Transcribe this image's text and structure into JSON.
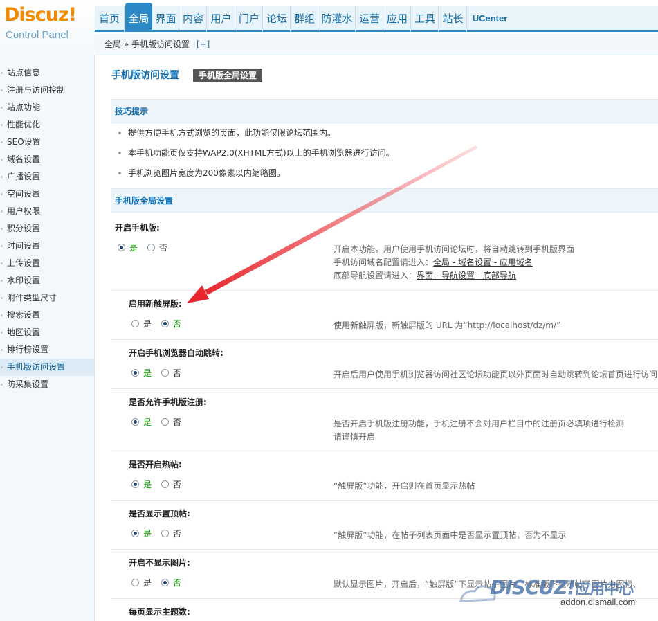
{
  "logo": {
    "brand_main": "Discuz",
    "brand_bang": "!",
    "subtitle": "Control Panel"
  },
  "nav": {
    "tabs": [
      {
        "label": "首页"
      },
      {
        "label": "全局",
        "active": true
      },
      {
        "label": "界面"
      },
      {
        "label": "内容"
      },
      {
        "label": "用户"
      },
      {
        "label": "门户"
      },
      {
        "label": "论坛"
      },
      {
        "label": "群组"
      },
      {
        "label": "防灌水"
      },
      {
        "label": "运营"
      },
      {
        "label": "应用"
      },
      {
        "label": "工具"
      },
      {
        "label": "站长"
      },
      {
        "label": "UCenter"
      }
    ]
  },
  "breadcrumb": {
    "root": "全局",
    "sep": "»",
    "current": "手机版访问设置",
    "plus": "[+]"
  },
  "sidebar": {
    "items": [
      {
        "label": "站点信息"
      },
      {
        "label": "注册与访问控制"
      },
      {
        "label": "站点功能"
      },
      {
        "label": "性能优化"
      },
      {
        "label": "SEO设置"
      },
      {
        "label": "域名设置"
      },
      {
        "label": "广播设置"
      },
      {
        "label": "空间设置"
      },
      {
        "label": "用户权限"
      },
      {
        "label": "积分设置"
      },
      {
        "label": "时间设置"
      },
      {
        "label": "上传设置"
      },
      {
        "label": "水印设置"
      },
      {
        "label": "附件类型尺寸"
      },
      {
        "label": "搜索设置"
      },
      {
        "label": "地区设置"
      },
      {
        "label": "排行榜设置"
      },
      {
        "label": "手机版访问设置",
        "active": true
      },
      {
        "label": "防采集设置"
      }
    ]
  },
  "page": {
    "title": "手机版访问设置",
    "tab_button": "手机版全局设置"
  },
  "tips": {
    "header": "技巧提示",
    "items": [
      "提供方便手机方式浏览的页面，此功能仅限论坛范围内。",
      "本手机功能页仅支持WAP2.0(XHTML方式)以上的手机浏览器进行访问。",
      "手机浏览图片宽度为200像素以内缩略图。"
    ]
  },
  "config": {
    "header": "手机版全局设置",
    "yes": "是",
    "no": "否",
    "settings": [
      {
        "label": "开启手机版:",
        "value": "yes",
        "desc": "开启本功能，用户使用手机访问论坛时，将自动跳转到手机版界面",
        "desc2_prefix": "手机访问域名配置请进入：",
        "desc2_link": "全局 - 域名设置 - 应用域名",
        "desc3_prefix": "底部导航设置请进入：",
        "desc3_link": "界面 - 导航设置 - 底部导航"
      },
      {
        "label": "启用新触屏版:",
        "value": "no",
        "desc": "使用新触屏版，新触屏版的 URL 为“http://localhost/dz/m/”"
      },
      {
        "label": "开启手机浏览器自动跳转:",
        "value": "yes",
        "desc": "开启后用户使用手机浏览器访问社区论坛功能页以外页面时自动跳转到论坛首页进行访问"
      },
      {
        "label": "是否允许手机版注册:",
        "value": "yes",
        "desc": "是否开启手机版注册功能，手机注册不会对用户栏目中的注册页必填项进行检测",
        "desc2": "请谨慎开启"
      },
      {
        "label": "是否开启热帖:",
        "value": "yes",
        "desc": "“触屏版”功能，开启则在首页显示热帖"
      },
      {
        "label": "是否显示置顶帖:",
        "value": "yes",
        "desc": "“触屏版”功能，在帖子列表页面中是否显示置顶帖，否为不显示"
      },
      {
        "label": "开启不显示图片:",
        "value": "no",
        "desc": "默认显示图片，开启后，“触屏版”下显示帖子图片，标准版下显示帖子图片为图标、"
      },
      {
        "label": "每页显示主题数:"
      }
    ]
  },
  "watermark": {
    "brand": "DISCUZ!",
    "brand_cn": "应用中心",
    "url": "addon.dismall.com"
  },
  "colors": {
    "accent": "#2b89c5",
    "title": "#0c6db2",
    "selected_option": "#0b9a00",
    "arrow": "#e8262e"
  }
}
